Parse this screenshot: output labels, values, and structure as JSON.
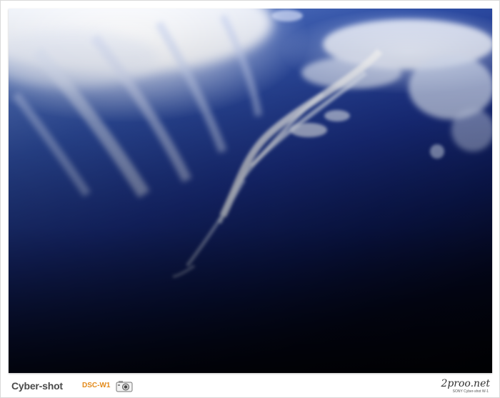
{
  "footer": {
    "brand": "Cyber-shot",
    "model": "DSC-W1",
    "site": "2proo.net",
    "site_sub": "SONY Cyber-shot W-1"
  },
  "icons": {
    "camera": "camera-icon"
  },
  "colors": {
    "sky_deep": "#050a2a",
    "sky_mid": "#1a2f86",
    "sky_light": "#6f8fcf",
    "model_accent": "#e38a1a"
  }
}
